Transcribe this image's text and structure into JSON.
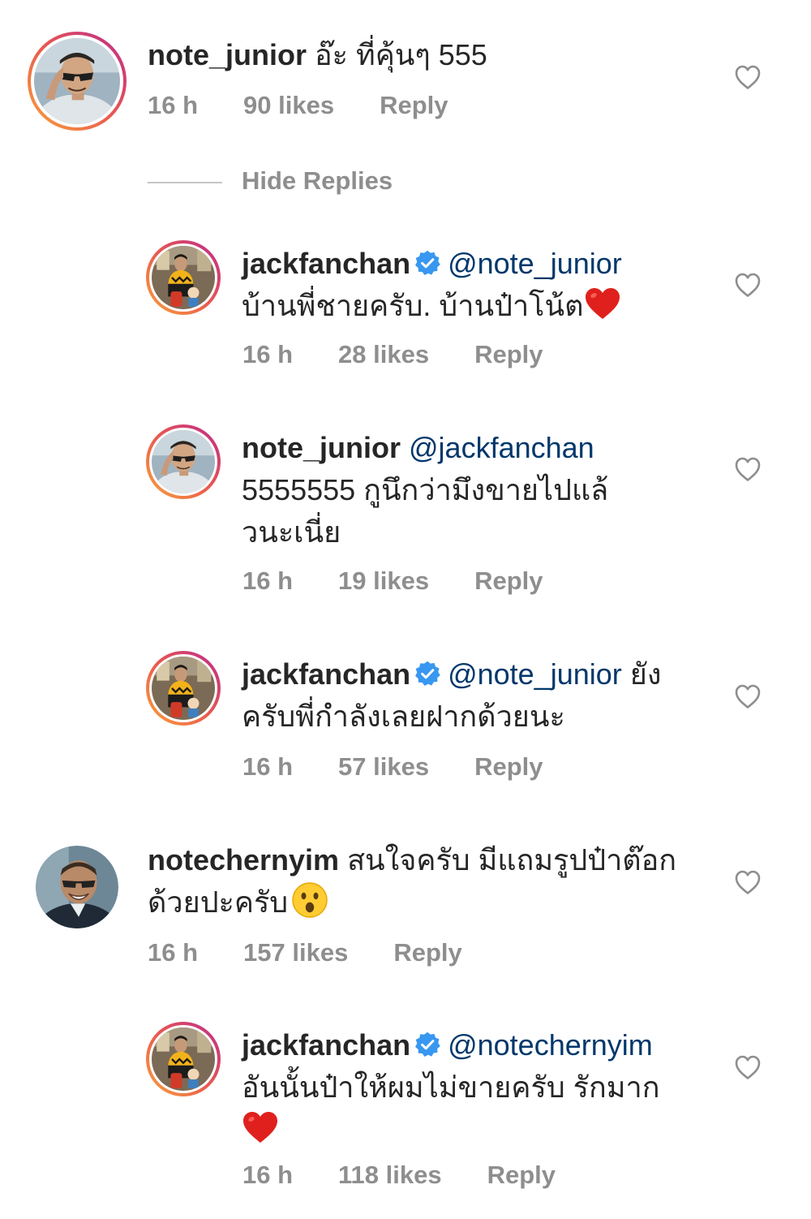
{
  "comments": [
    {
      "username": "note_junior",
      "text": " อ๊ะ ที่คุ้นๆ 555",
      "time": "16 h",
      "likes": "90 likes",
      "reply": "Reply"
    },
    {
      "username": "jackfanchan",
      "mention": "@note_junior",
      "text": "บ้านพี่ชายครับ. บ้านป๋าโน้ต",
      "time": "16 h",
      "likes": "28 likes",
      "reply": "Reply"
    },
    {
      "username": "note_junior",
      "mention": "@jackfanchan",
      "text_line1": "5555555 กูนึกว่ามึงขายไปแล้",
      "text_line2": "วนะเนี่ย",
      "time": "16 h",
      "likes": "19 likes",
      "reply": "Reply"
    },
    {
      "username": "jackfanchan",
      "mention": "@note_junior",
      "text_tail": " ยัง",
      "text_line2": "ครับพี่กำลังเลยฝากด้วยนะ",
      "time": "16 h",
      "likes": "57 likes",
      "reply": "Reply"
    },
    {
      "username": "notechernyim",
      "text": " สนใจครับ มีแถมรูปป๋าต๊อก",
      "text_line2": "ด้วยปะครับ",
      "time": "16 h",
      "likes": "157 likes",
      "reply": "Reply"
    },
    {
      "username": "jackfanchan",
      "mention": "@notechernyim",
      "text_line2": "อันนั้นป๋าให้ผมไม่ขายครับ รักมาก",
      "time": "16 h",
      "likes": "118 likes",
      "reply": "Reply"
    }
  ],
  "hide_replies": "Hide Replies",
  "colors": {
    "text": "#262626",
    "mention": "#00376b",
    "meta": "#8e8e8e",
    "verified": "#3897f0",
    "heart_emoji": "#e0201c"
  },
  "icons": {
    "like": "heart-outline-icon",
    "verified": "verified-badge-icon",
    "emoji_heart": "red-heart-emoji",
    "emoji_face": "surprised-face-emoji"
  }
}
